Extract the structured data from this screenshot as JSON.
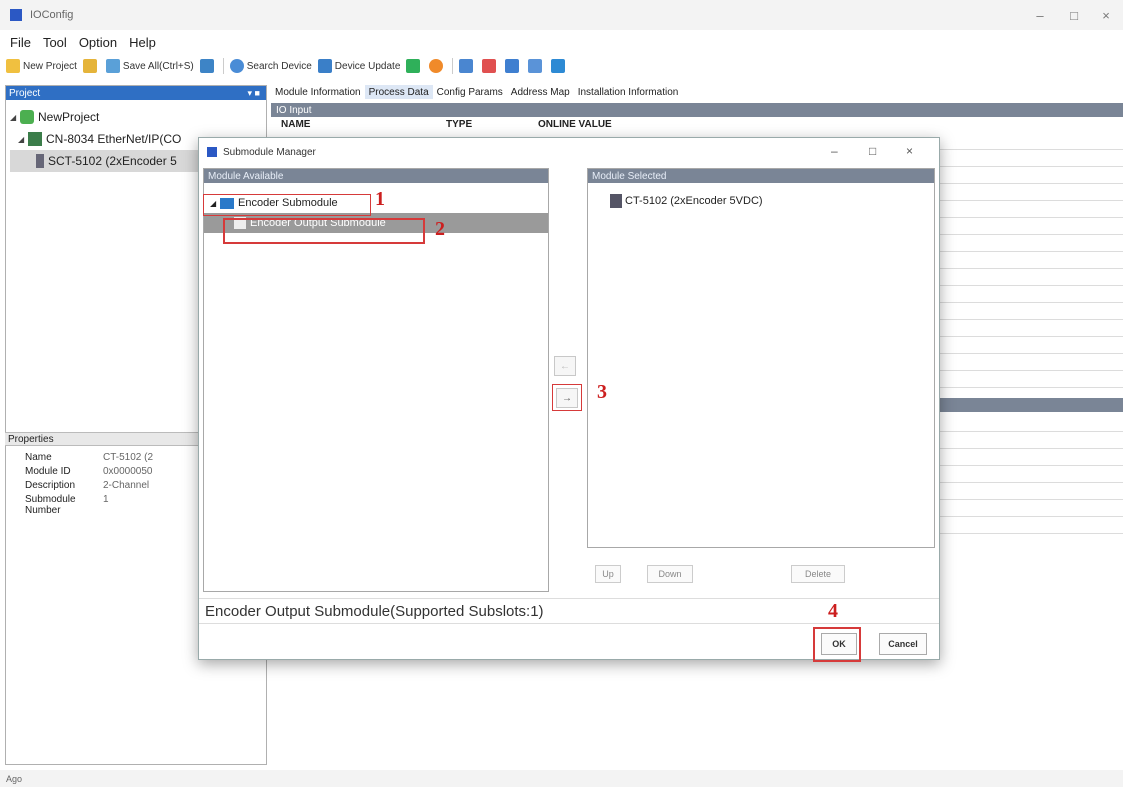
{
  "app": {
    "title": "IOConfig",
    "status": "Ago"
  },
  "menu": [
    "File",
    "Tool",
    "Option",
    "Help"
  ],
  "toolbar": {
    "new_project": "New Project",
    "save_all": "Save All(Ctrl+S)",
    "search_device": "Search Device",
    "device_update": "Device Update"
  },
  "project_pane": {
    "header": "Project",
    "tree": {
      "root": "NewProject",
      "coupler": "CN-8034 EtherNet/IP(CO",
      "module": "SCT-5102 (2xEncoder 5"
    }
  },
  "properties": {
    "header": "Properties",
    "rows": [
      {
        "name": "Name",
        "value": "CT-5102 (2"
      },
      {
        "name": "Module ID",
        "value": "0x0000050"
      },
      {
        "name": "Description",
        "value": "2-Channel"
      },
      {
        "name": "Submodule Number",
        "value": "1"
      }
    ]
  },
  "main": {
    "tabs": [
      "Module Information",
      "Process Data",
      "Config Params",
      "Address Map",
      "Installation Information"
    ],
    "section": "IO Input",
    "columns": [
      "NAME",
      "TYPE",
      "ONLINE VALUE"
    ]
  },
  "dialog": {
    "title": "Submodule Manager",
    "available_header": "Module Available",
    "selected_header": "Module Selected",
    "folder": "Encoder Submodule",
    "item": "Encoder Output Submodule",
    "selected_item": "CT-5102 (2xEncoder 5VDC)",
    "move_up": "←",
    "move_right": "→",
    "btn_up": "Up",
    "btn_down": "Down",
    "btn_delete": "Delete",
    "status": "Encoder Output Submodule(Supported Subslots:1)",
    "ok": "OK",
    "cancel": "Cancel",
    "steps": [
      "1",
      "2",
      "3",
      "4"
    ]
  }
}
